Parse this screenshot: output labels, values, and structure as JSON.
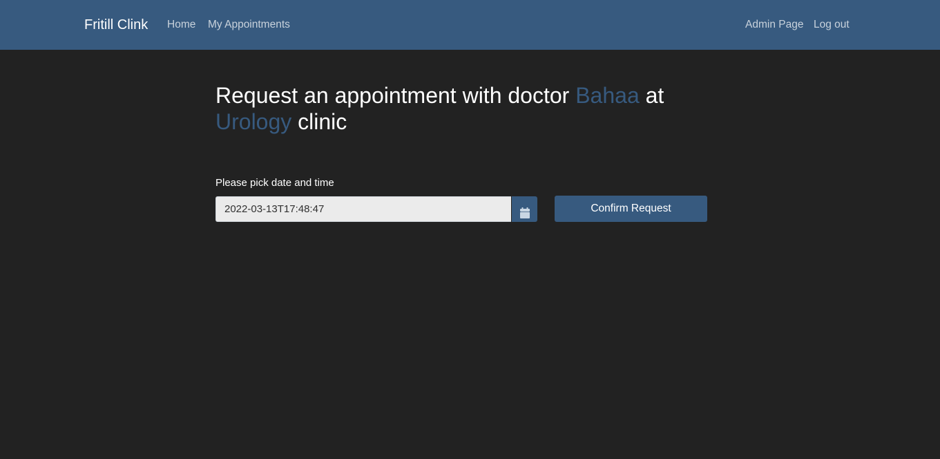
{
  "navbar": {
    "brand": "Fritill Clink",
    "left_links": [
      "Home",
      "My Appointments"
    ],
    "right_links": [
      "Admin Page",
      "Log out"
    ]
  },
  "heading": {
    "prefix": "Request an appointment with doctor ",
    "doctor": "Bahaa",
    "middle": " at ",
    "clinic": "Urology",
    "suffix": " clinic"
  },
  "form": {
    "label": "Please pick date and time",
    "datetime_value": "2022-03-13T17:48:47",
    "calendar_icon": "calendar-icon",
    "confirm_label": "Confirm Request"
  },
  "colors": {
    "navbar_bg": "#375a7f",
    "page_bg": "#222222",
    "accent": "#375a7f",
    "input_bg": "#ebebeb"
  }
}
